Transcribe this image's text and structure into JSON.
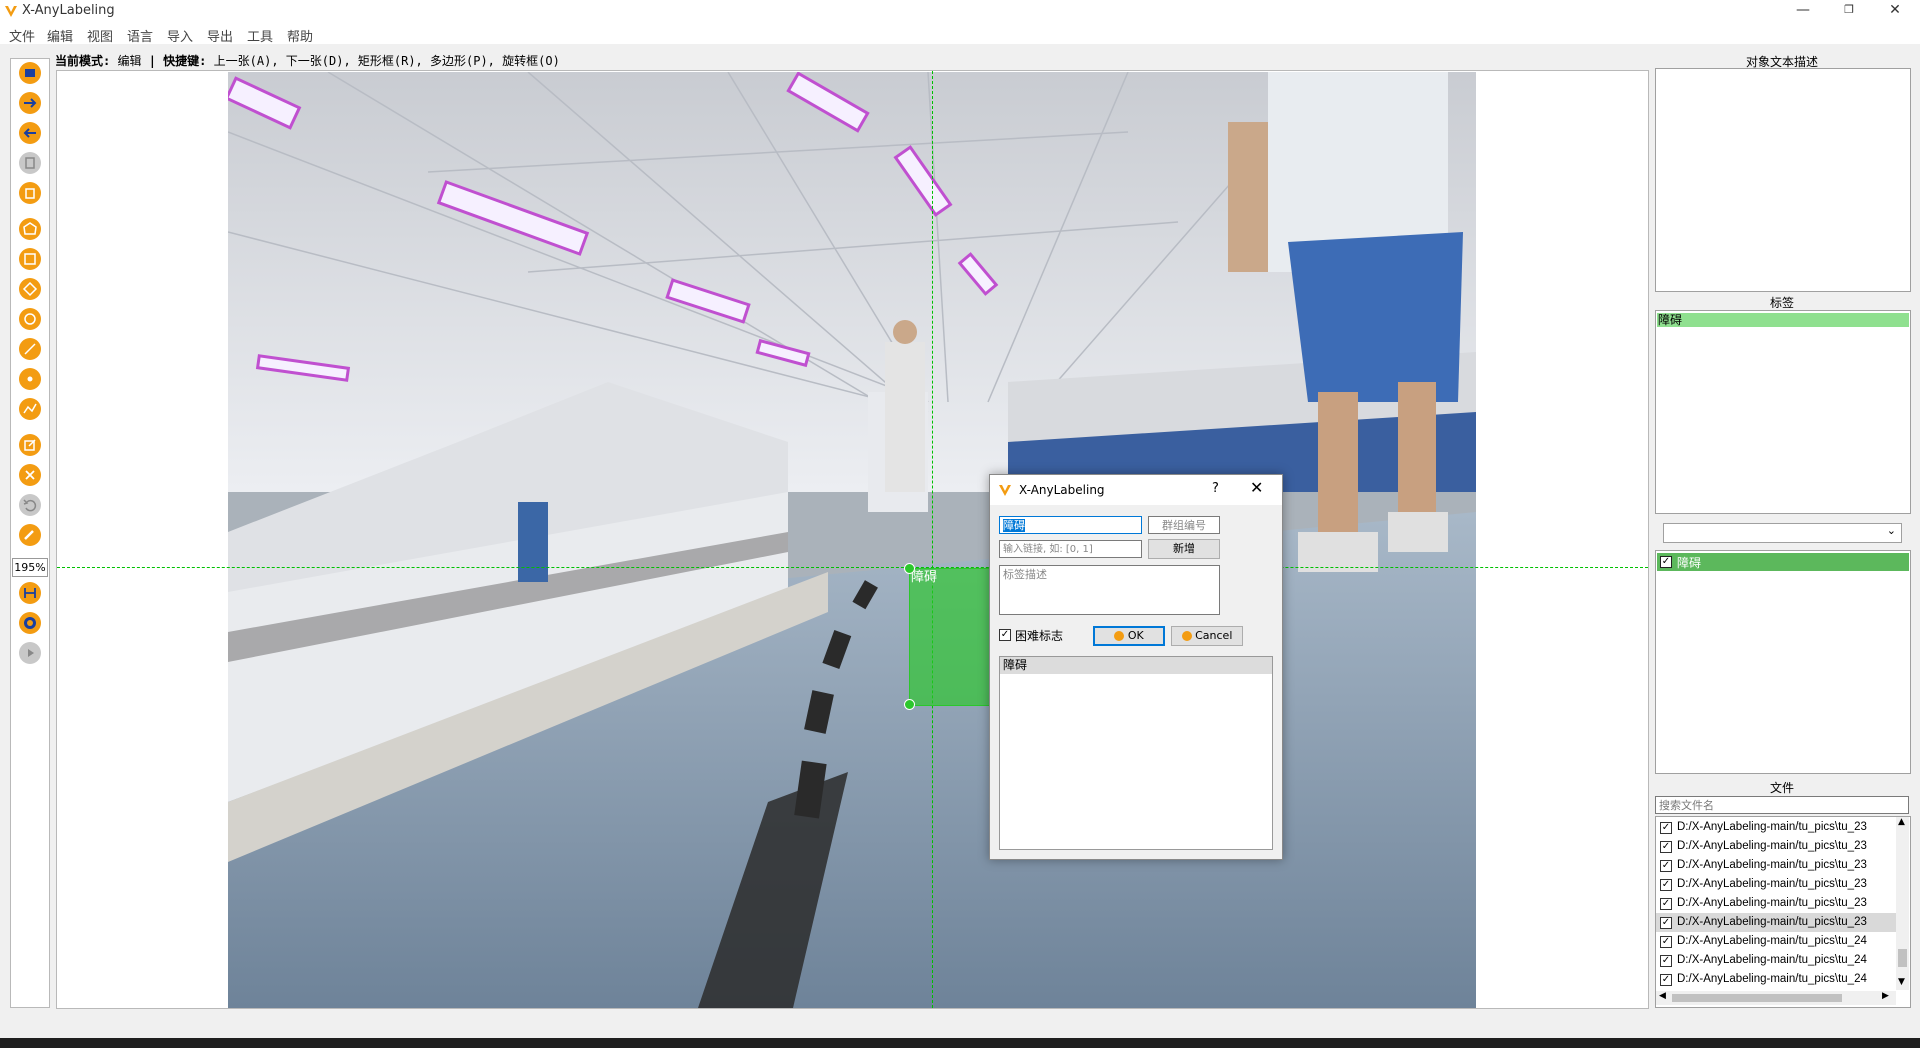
{
  "window": {
    "title": "X-AnyLabeling",
    "minimize": "—",
    "restore": "❐",
    "close": "✕"
  },
  "menu": [
    "文件",
    "编辑",
    "视图",
    "语言",
    "导入",
    "导出",
    "工具",
    "帮助"
  ],
  "modebar": {
    "mode_label": "当前模式:",
    "mode_value": "编辑",
    "shortcut_label": "快捷键:",
    "shortcut_value": "上一张(A), 下一张(D), 矩形框(R), 多边形(P), 旋转框(O)"
  },
  "toolbar": {
    "icons": [
      "open-folder-icon",
      "next-image-icon",
      "prev-image-icon",
      "save-icon",
      "delete-icon",
      "polygon-icon",
      "rectangle-icon",
      "rotation-icon",
      "circle-icon",
      "line-icon",
      "point-icon",
      "linestrip-icon",
      "edit-icon",
      "delete-shape-icon",
      "undo-icon",
      "brush-icon",
      "fit-width-icon",
      "ai-icon",
      "run-icon"
    ],
    "zoom": "195%"
  },
  "canvas": {
    "annotation_label": "障碍"
  },
  "dialog": {
    "title": "X-AnyLabeling",
    "help": "?",
    "close": "✕",
    "label_value": "障碍",
    "group_placeholder": "群组编号",
    "link_placeholder": "输入链接, 如: [0, 1]",
    "add_button": "新增",
    "description_placeholder": "标签描述",
    "difficult_label": "困难标志",
    "difficult_checked": true,
    "ok_button": "OK",
    "cancel_button": "Cancel",
    "list_items": [
      "障碍"
    ]
  },
  "right_panel": {
    "description_title": "对象文本描述",
    "labels_title": "标签",
    "labels": [
      "障碍"
    ],
    "dropdown_value": "",
    "shapes": [
      {
        "label": "障碍",
        "checked": true
      }
    ],
    "files_title": "文件",
    "file_search_placeholder": "搜索文件名",
    "files": [
      "D:/X-AnyLabeling-main/tu_pics\\tu_23",
      "D:/X-AnyLabeling-main/tu_pics\\tu_23",
      "D:/X-AnyLabeling-main/tu_pics\\tu_23",
      "D:/X-AnyLabeling-main/tu_pics\\tu_23",
      "D:/X-AnyLabeling-main/tu_pics\\tu_23",
      "D:/X-AnyLabeling-main/tu_pics\\tu_23",
      "D:/X-AnyLabeling-main/tu_pics\\tu_24",
      "D:/X-AnyLabeling-main/tu_pics\\tu_24",
      "D:/X-AnyLabeling-main/tu_pics\\tu_24"
    ],
    "selected_file_index": 5
  },
  "colors": {
    "accent": "#f39c12",
    "label_green": "#8fe08f",
    "box_green": "#2cc72c"
  }
}
